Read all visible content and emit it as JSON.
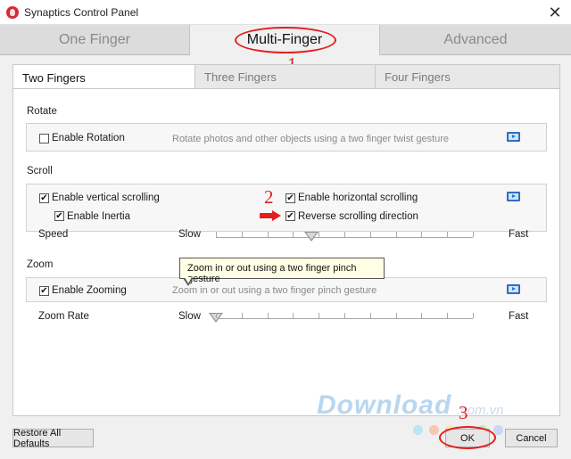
{
  "window": {
    "title": "Synaptics Control Panel",
    "close_glyph": "✕",
    "icon": "synaptics-logo-icon"
  },
  "main_tabs": [
    {
      "label": "One Finger",
      "active": false
    },
    {
      "label": "Multi-Finger",
      "active": true
    },
    {
      "label": "Advanced",
      "active": false
    }
  ],
  "sub_tabs": [
    {
      "label": "Two Fingers",
      "active": true
    },
    {
      "label": "Three Fingers",
      "active": false
    },
    {
      "label": "Four Fingers",
      "active": false
    }
  ],
  "rotate": {
    "section_label": "Rotate",
    "enable_label": "Enable Rotation",
    "enabled": false,
    "description": "Rotate photos and other objects using a two finger twist gesture"
  },
  "scroll": {
    "section_label": "Scroll",
    "vertical_label": "Enable vertical scrolling",
    "vertical_checked": true,
    "inertia_label": "Enable Inertia",
    "inertia_checked": true,
    "horizontal_label": "Enable horizontal scrolling",
    "horizontal_checked": true,
    "reverse_label": "Reverse scrolling direction",
    "reverse_checked": true,
    "speed_label": "Speed",
    "slow_label": "Slow",
    "fast_label": "Fast",
    "speed_value": 0.37
  },
  "zoom": {
    "section_label": "Zoom",
    "tooltip": "Zoom in or out using a two finger pinch gesture",
    "enable_label": "Enable Zooming",
    "enabled": true,
    "description": "Zoom in or out using a two finger pinch gesture",
    "rate_label": "Zoom Rate",
    "slow_label": "Slow",
    "fast_label": "Fast",
    "rate_value": 0.0
  },
  "annotations": {
    "n1": "1",
    "n2": "2",
    "n3": "3"
  },
  "buttons": {
    "restore": "Restore All Defaults",
    "ok": "OK",
    "cancel": "Cancel"
  },
  "watermark": {
    "main": "Download",
    "suffix": ".com.vn"
  },
  "colors": {
    "annotation": "#e01f1f",
    "watermark": "#b9d6ef",
    "video_icon": "#2d6fc0"
  },
  "check_glyph": "✔"
}
